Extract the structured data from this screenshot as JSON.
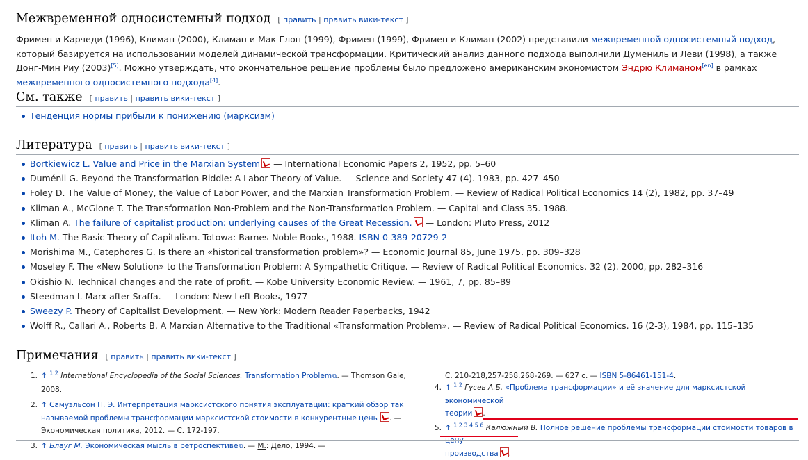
{
  "sections": {
    "intertemporal": {
      "title": "Межвременной односистемный подход",
      "edit": "править",
      "edit_wiki": "править вики-текст",
      "para": {
        "t1": "Фримен и Карчеди (1996), Климан (2000), Климан и Мак-Глон (1999), Фримен (1999), Фримен и Климан (2002) представили ",
        "l1": "межвременной односистемный подход",
        "t2": ", который базируется на использовании моделей динамической трансформации. Критический анализ данного подхода выполнили Думениль и Леви (1998), а также Донг-Мин Риу (2003)",
        "sup1": "[5]",
        "t3": ". Можно утверждать, что окончательное решение проблемы было предложено американским экономистом ",
        "l2": "Эндрю Климаном",
        "sup2": "[en]",
        "t4": " в рамках ",
        "l3": "межвременного односистемного подхода",
        "sup3": "[4]",
        "t5": "."
      }
    },
    "see_also": {
      "title": "См. также",
      "edit": "править",
      "edit_wiki": "править вики-текст",
      "items": [
        "Тенденция нормы прибыли к понижению (марксизм)"
      ]
    },
    "literature": {
      "title": "Литература",
      "edit": "править",
      "edit_wiki": "править вики-текст",
      "items": [
        {
          "link": "Bortkiewicz L. Value and Price in the Marxian System",
          "pdf": true,
          "text": " — International Economic Papers 2, 1952, pp. 5–60"
        },
        {
          "link": "",
          "pdf": false,
          "text": "Duménil G. Beyond the Transformation Riddle: A Labor Theory of Value. — Science and Society 47 (4). 1983, pp. 427–450"
        },
        {
          "link": "",
          "pdf": false,
          "text": "Foley D. The Value of Money, the Value of Labor Power, and the Marxian Transformation Problem. — Review of Radical Political Economics 14 (2), 1982, pp. 37–49"
        },
        {
          "link": "",
          "pdf": false,
          "text": "Kliman A., McGlone T. The Transformation Non-Problem and the Non-Transformation Problem. — Capital and Class 35. 1988."
        },
        {
          "pre": "Kliman A. ",
          "link": "The failure of capitalist production: underlying causes of the Great Recession.",
          "pdf": true,
          "text": " — London: Pluto Press, 2012"
        },
        {
          "link": "Itoh M.",
          "pdf": false,
          "text": " The Basic Theory of Capitalism. Totowa: Barnes-Noble Books, 1988. ",
          "link2": "ISBN 0-389-20729-2"
        },
        {
          "link": "",
          "pdf": false,
          "text": "Morishima M., Catephores G. Is there an «historical transformation problem»? — Economic Journal 85, June 1975. pp. 309–328"
        },
        {
          "link": "",
          "pdf": false,
          "text": "Moseley F. The «New Solution» to the Transformation Problem: A Sympathetic Critique. — Review of Radical Political Economics. 32 (2). 2000, pp. 282–316"
        },
        {
          "link": "",
          "pdf": false,
          "text": "Okishio N. Technical changes and the rate of profit. — Kobe University Economic Review. — 1961, 7, pp. 85–89"
        },
        {
          "link": "",
          "pdf": false,
          "text": "Steedman I. Marx after Sraffa. — London: New Left Books, 1977"
        },
        {
          "link": "Sweezy P.",
          "pdf": false,
          "text": " Theory of Capitalist Development. — New York: Modern Reader Paperbacks, 1942"
        },
        {
          "link": "",
          "pdf": false,
          "text": "Wolff R., Callari A., Roberts B. A Marxian Alternative to the Traditional «Transformation Problem». — Review of Radical Political Economics. 16 (2-3), 1984, pp. 115–135"
        }
      ]
    },
    "notes": {
      "title": "Примечания",
      "edit": "править",
      "edit_wiki": "править вики-текст",
      "n1": {
        "num": "1.",
        "arrow": "↑",
        "sups": "1 2",
        "i": "International Encyclopedia of the Social Sciences. ",
        "link": "Transformation Problem",
        "text": ". — Thomson Gale, 2008."
      },
      "n2": {
        "num": "2.",
        "arrow": "↑",
        "link_a": "Самуэльсон П. Э. Интерпретация марксистского понятия эксплуатации: краткий обзор так",
        "link_b": "называемой проблемы трансформации марксистской стоимости в конкурентные цены",
        "text_a": ". —",
        "text_b": "Экономическая политика, 2012. — С. 172-197."
      },
      "n3": {
        "num": "3.",
        "arrow": "↑",
        "link": "Блауг М.",
        "linktext": " Экономическая мысль в ретроспективе",
        "text": ". — ",
        "m": "М.",
        "text2": ": Дело, 1994. —"
      },
      "cont": {
        "text": "С. 210-218,257-258,268-269. — 627 с. — ",
        "link": "ISBN 5-86461-151-4",
        "end": "."
      },
      "n4": {
        "num": "4.",
        "arrow": "↑",
        "sups": "1 2",
        "author": "Гусев А.Б.",
        "link_a": " «Проблема трансформации» и её значение для марксистской экономической",
        "link_b": "теории",
        "end": "."
      },
      "n5": {
        "num": "5.",
        "arrow": "↑",
        "sups": "1 2 3 4 5 6",
        "author": "Калюжный В.",
        "link_a": "Полное решение проблемы трансформации стоимости товаров в цену",
        "link_b": "производства",
        "end": "."
      }
    }
  },
  "colors": {
    "link": "#0645ad",
    "redlink": "#ba0000",
    "annotation": "#e0001a"
  }
}
